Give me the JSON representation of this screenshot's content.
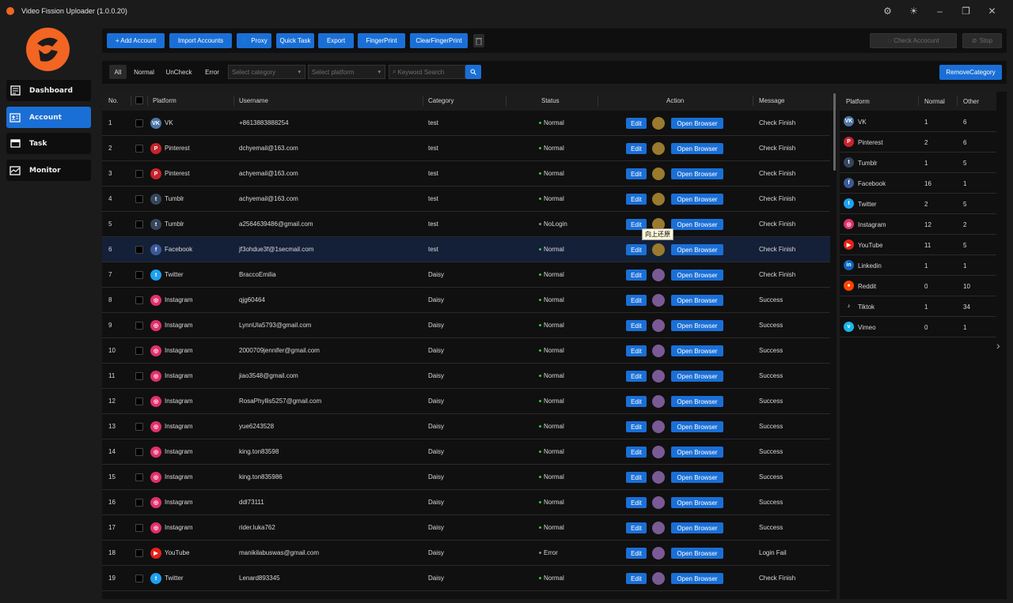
{
  "window": {
    "title": "Video Fission Uploader (1.0.0.20)"
  },
  "sidebar": {
    "items": [
      {
        "label": "Dashboard",
        "icon": "dashboard-icon",
        "active": false
      },
      {
        "label": "Account",
        "icon": "account-card-icon",
        "active": true
      },
      {
        "label": "Task",
        "icon": "task-icon",
        "active": false
      },
      {
        "label": "Monitor",
        "icon": "monitor-icon",
        "active": false
      }
    ]
  },
  "toolbar": {
    "add_account": "+ Add Account",
    "import_accounts": "Import Accounts",
    "proxy": "Proxy",
    "quick_task": "Quick Task",
    "export": "Export",
    "fingerprint": "FingerPrint",
    "clear_fingerprint": "ClearFingerPrint",
    "check_account": "Check Accocunt",
    "stop": "Stop"
  },
  "filters": {
    "tabs": [
      "All",
      "Normal",
      "UnCheck",
      "Error"
    ],
    "active_tab": "All",
    "category_placeholder": "Select category",
    "platform_placeholder": "Select platform",
    "keyword_placeholder": "Keyword Search",
    "remove_category": "RemoveCategory"
  },
  "table": {
    "columns": {
      "no": "No.",
      "platform": "Platform",
      "username": "Username",
      "category": "Category",
      "status": "Status",
      "action": "Action",
      "message": "Message"
    },
    "edit_label": "Edit",
    "open_label": "Open Browser",
    "tooltip": "向上还原",
    "rows": [
      {
        "no": "1",
        "platform": "VK",
        "username": "+8613883888254",
        "category": "test",
        "status": "Normal",
        "message": "Check Finish"
      },
      {
        "no": "2",
        "platform": "Pinterest",
        "username": "dchyemail@163.com",
        "category": "test",
        "status": "Normal",
        "message": "Check Finish"
      },
      {
        "no": "3",
        "platform": "Pinterest",
        "username": "achyemail@163.com",
        "category": "test",
        "status": "Normal",
        "message": "Check Finish"
      },
      {
        "no": "4",
        "platform": "Tumblr",
        "username": "achyemail@163.com",
        "category": "test",
        "status": "Normal",
        "message": "Check Finish"
      },
      {
        "no": "5",
        "platform": "Tumblr",
        "username": "a2564639486@gmail.com",
        "category": "test",
        "status": "NoLogin",
        "message": "Check Finish"
      },
      {
        "no": "6",
        "platform": "Facebook",
        "username": "jf3ohdue3f@1secmail.com",
        "category": "test",
        "status": "Normal",
        "message": "Check Finish"
      },
      {
        "no": "7",
        "platform": "Twitter",
        "username": "BraccoEmilia",
        "category": "Daisy",
        "status": "Normal",
        "message": "Check Finish"
      },
      {
        "no": "8",
        "platform": "Instagram",
        "username": "qjg60464",
        "category": "Daisy",
        "status": "Normal",
        "message": "Success"
      },
      {
        "no": "9",
        "platform": "Instagram",
        "username": "LynnUla5793@gmail.com",
        "category": "Daisy",
        "status": "Normal",
        "message": "Success"
      },
      {
        "no": "10",
        "platform": "Instagram",
        "username": "2000709jennifer@gmail.com",
        "category": "Daisy",
        "status": "Normal",
        "message": "Success"
      },
      {
        "no": "11",
        "platform": "Instagram",
        "username": "jiao3548@gmail.com",
        "category": "Daisy",
        "status": "Normal",
        "message": "Success"
      },
      {
        "no": "12",
        "platform": "Instagram",
        "username": "RosaPhyllis5257@gmail.com",
        "category": "Daisy",
        "status": "Normal",
        "message": "Success"
      },
      {
        "no": "13",
        "platform": "Instagram",
        "username": "yue6243528",
        "category": "Daisy",
        "status": "Normal",
        "message": "Success"
      },
      {
        "no": "14",
        "platform": "Instagram",
        "username": "king.ton83598",
        "category": "Daisy",
        "status": "Normal",
        "message": "Success"
      },
      {
        "no": "15",
        "platform": "Instagram",
        "username": "king.ton835986",
        "category": "Daisy",
        "status": "Normal",
        "message": "Success"
      },
      {
        "no": "16",
        "platform": "Instagram",
        "username": "ddl73111",
        "category": "Daisy",
        "status": "Normal",
        "message": "Success"
      },
      {
        "no": "17",
        "platform": "Instagram",
        "username": "rider.luka762",
        "category": "Daisy",
        "status": "Normal",
        "message": "Success"
      },
      {
        "no": "18",
        "platform": "YouTube",
        "username": "manikilabuswas@gmail.com",
        "category": "Daisy",
        "status": "Error",
        "message": "Login Fail"
      },
      {
        "no": "19",
        "platform": "Twitter",
        "username": "Lenard893345",
        "category": "Daisy",
        "status": "Normal",
        "message": "Check Finish"
      }
    ]
  },
  "stats": {
    "columns": {
      "platform": "Platform",
      "normal": "Normal",
      "other": "Other"
    },
    "rows": [
      {
        "platform": "VK",
        "normal": "1",
        "other": "6"
      },
      {
        "platform": "Pinterest",
        "normal": "2",
        "other": "6"
      },
      {
        "platform": "Tumblr",
        "normal": "1",
        "other": "5"
      },
      {
        "platform": "Facebook",
        "normal": "16",
        "other": "1"
      },
      {
        "platform": "Twitter",
        "normal": "2",
        "other": "5"
      },
      {
        "platform": "Instagram",
        "normal": "12",
        "other": "2"
      },
      {
        "platform": "YouTube",
        "normal": "11",
        "other": "5"
      },
      {
        "platform": "Linkedin",
        "normal": "1",
        "other": "1"
      },
      {
        "platform": "Reddit",
        "normal": "0",
        "other": "10"
      },
      {
        "platform": "Tiktok",
        "normal": "1",
        "other": "34"
      },
      {
        "platform": "Vimeo",
        "normal": "0",
        "other": "1"
      }
    ]
  },
  "colors": {
    "accent": "#1a6fd6",
    "brand": "#f26522",
    "status_normal": "#2ecc40",
    "status_other": "#8c8c8c",
    "circle_test": "#9a7a2e",
    "circle_daisy": "#7a5a95"
  },
  "platform_icons": {
    "VK": {
      "bg": "#4c75a3",
      "glyph": "VK"
    },
    "Pinterest": {
      "bg": "#c8232c",
      "glyph": "P"
    },
    "Tumblr": {
      "bg": "#35465c",
      "glyph": "t"
    },
    "Facebook": {
      "bg": "#3b5998",
      "glyph": "f"
    },
    "Twitter": {
      "bg": "#1da1f2",
      "glyph": "t"
    },
    "Instagram": {
      "bg": "#e1306c",
      "glyph": "◎"
    },
    "YouTube": {
      "bg": "#e62117",
      "glyph": "▶"
    },
    "Linkedin": {
      "bg": "#0a66c2",
      "glyph": "in"
    },
    "Reddit": {
      "bg": "#ff4500",
      "glyph": "●"
    },
    "Tiktok": {
      "bg": "#111111",
      "glyph": "♪"
    },
    "Vimeo": {
      "bg": "#1ab7ea",
      "glyph": "v"
    }
  }
}
